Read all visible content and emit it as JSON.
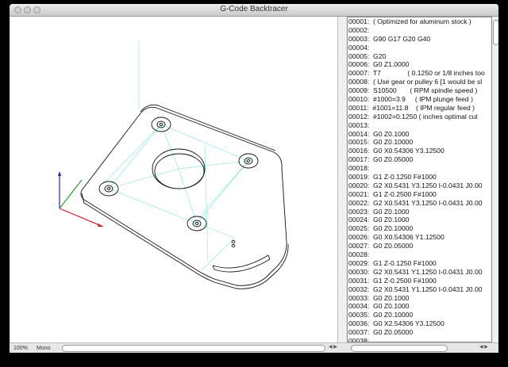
{
  "window": {
    "title": "G-Code Backtracer"
  },
  "status": {
    "zoom": "100%",
    "font": "Mono"
  },
  "colors": {
    "axis_x": "#d0202a",
    "axis_y": "#2aa02a",
    "axis_z": "#2020b0",
    "toolpath": "#5fe0d8"
  },
  "code_lines": [
    "00001:  ( Optimized for aluminum stock )",
    "00002:",
    "00003:  G90 G17 G20 G40",
    "00004:",
    "00005:  G20",
    "00006:  G0 Z1.0000",
    "00007:  T7              ( 0.1250 or 1/8 inches too",
    "00008:  ( Use gear or pulley 6 [1 would be sl",
    "00009:  S10500       ( RPM spindle speed )",
    "00010:  #1000=3.9     ( IPM plunge feed )",
    "00011:  #1001=11.8    ( IPM regular feed )",
    "00012:  #1002=0.1250 ( inches optimal cut",
    "00013:",
    "00014:  G0 Z0.1000",
    "00015:  G0 Z0.10000",
    "00016:  G0 X0.54306 Y3.12500",
    "00017:  G0 Z0.05000",
    "00018:",
    "00019:  G1 Z-0.1250 F#1000",
    "00020:  G2 X0.5431 Y3.1250 I-0.0431 J0.00",
    "00021:  G1 Z-0.2500 F#1000",
    "00022:  G2 X0.5431 Y3.1250 I-0.0431 J0.00",
    "00023:  G0 Z0.1000",
    "00024:  G0 Z0.1000",
    "00025:  G0 Z0.10000",
    "00026:  G0 X0.54306 Y1.12500",
    "00027:  G0 Z0.05000",
    "00028:",
    "00029:  G1 Z-0.1250 F#1000",
    "00030:  G2 X0.5431 Y1.1250 I-0.0431 J0.00",
    "00031:  G1 Z-0.2500 F#1000",
    "00032:  G2 X0.5431 Y1.1250 I-0.0431 J0.00",
    "00033:  G0 Z0.1000",
    "00034:  G0 Z0.1000",
    "00035:  G0 Z0.10000",
    "00036:  G0 X2.54306 Y3.12500",
    "00037:  G0 Z0.05000",
    "00038:"
  ]
}
